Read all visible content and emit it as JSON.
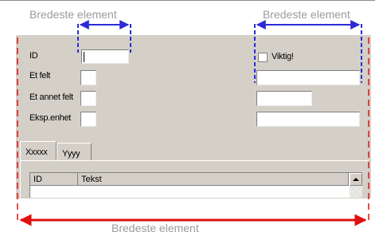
{
  "annotations": {
    "top_left": "Bredeste element",
    "top_right": "Bredeste element",
    "bottom": "Bredeste element"
  },
  "form": {
    "id_label": "ID",
    "field1_label": "Et felt",
    "field2_label": "Et annet felt",
    "field3_label": "Eksp.enhet",
    "checkbox_label": "Viktig!"
  },
  "tabs": [
    {
      "label": "Xxxxx",
      "selected": true
    },
    {
      "label": "Yyyy",
      "selected": false
    }
  ],
  "grid": {
    "columns": [
      "ID",
      "Tekst"
    ]
  },
  "colors": {
    "annotation_blue": "#2b2bd6",
    "annotation_red": "#e01010",
    "panel": "#d4d0c8"
  }
}
